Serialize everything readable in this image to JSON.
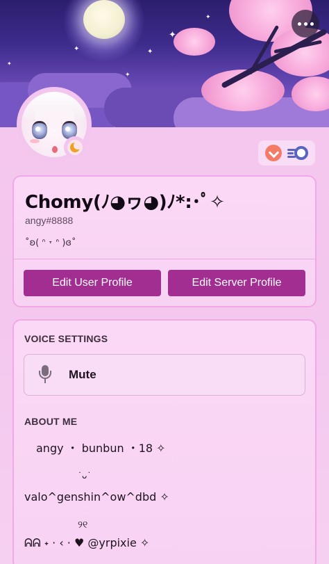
{
  "header": {
    "more_icon": "ellipsis-icon"
  },
  "profile": {
    "display_name": "Chomy(ﾉ◕ヮ◕)ﾉ*:･ﾟ✧",
    "tag": "angy#8888",
    "custom_status": "˚ʚ( ᐢ ˕ ᐢ )ɞ˚",
    "status": "idle",
    "badges": [
      "hypesquad-icon",
      "nitro-icon"
    ],
    "edit_user_profile": "Edit User Profile",
    "edit_server_profile": "Edit Server Profile"
  },
  "voice_settings": {
    "title": "VOICE SETTINGS",
    "mute_label": "Mute"
  },
  "about_me": {
    "title": "ABOUT ME",
    "line1": "angy ・ bunbun ・18 ✧",
    "kaomoji1": "˙ᴗ˙",
    "line2": "valo^genshin^ow^dbd ✧",
    "kaomoji2": "୨୧",
    "line3": "ᕱᕱ ˖ · ‹ · ♥ @yrpixie ✧"
  },
  "colors": {
    "accent_button": "#a32e92",
    "card_border": "#f2a8e8",
    "background": "#f3c6ee"
  }
}
